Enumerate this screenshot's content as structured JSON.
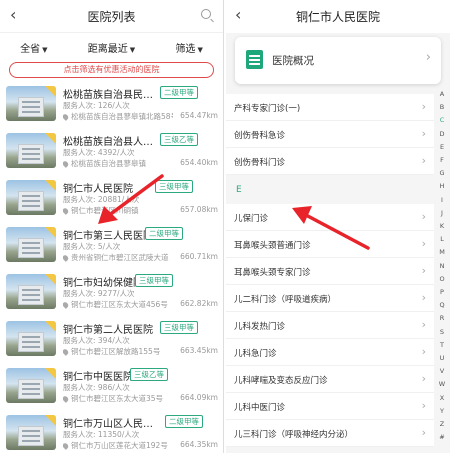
{
  "left": {
    "header": {
      "back_icon": "‹",
      "title": "医院列表"
    },
    "filters": [
      {
        "label": "全省"
      },
      {
        "label": "距离最近"
      },
      {
        "label": "筛选"
      }
    ],
    "banner": "点击筛选有优惠活动的医院",
    "hospitals": [
      {
        "name": "松桃苗族自治县民族...",
        "grade": "二级甲等",
        "served": "服务人次: 126/人次",
        "address": "松桃苗族自治县蓼皋镇北路58号",
        "distance": "654.47km"
      },
      {
        "name": "松桃苗族自治县人民...",
        "grade": "三级乙等",
        "served": "服务人次: 4392/人次",
        "address": "松桃苗族自治县蓼皋镇",
        "distance": "654.40km"
      },
      {
        "name": "铜仁市人民医院",
        "grade": "三级甲等",
        "served": "服务人次: 20881/人次",
        "address": "铜仁市碧江区川硐镇",
        "distance": "657.08km"
      },
      {
        "name": "铜仁市第三人民医院",
        "grade": "二级甲等",
        "served": "服务人次: 5/人次",
        "address": "贵州省铜仁市碧江区武陵大道",
        "distance": "660.71km"
      },
      {
        "name": "铜仁市妇幼保健院",
        "grade": "三级甲等",
        "served": "服务人次: 9277/人次",
        "address": "铜仁市碧江区东太大道456号",
        "distance": "662.82km"
      },
      {
        "name": "铜仁市第二人民医院",
        "grade": "三级甲等",
        "served": "服务人次: 394/人次",
        "address": "铜仁市碧江区解放路155号",
        "distance": "663.45km"
      },
      {
        "name": "铜仁市中医医院",
        "grade": "三级乙等",
        "served": "服务人次: 986/人次",
        "address": "铜仁市碧江区东太大道35号",
        "distance": "664.09km"
      },
      {
        "name": "铜仁市万山区人民医院",
        "grade": "二级甲等",
        "served": "服务人次: 11350/人次",
        "address": "铜仁市万山区莲花大道192号",
        "distance": "664.35km"
      }
    ]
  },
  "right": {
    "header": {
      "back_icon": "‹",
      "title": "铜仁市人民医院"
    },
    "overview_label": "医院概况",
    "group1": [
      "产科专家门诊(一)",
      "创伤骨科急诊",
      "创伤骨科门诊"
    ],
    "section_letter": "E",
    "group2": [
      "儿保门诊",
      "耳鼻喉头颈普通门诊",
      "耳鼻喉头颈专家门诊",
      "儿二科门诊（呼吸道疾病）",
      "儿科发热门诊",
      "儿科急门诊",
      "儿科哮喘及变态反应门诊",
      "儿科中医门诊",
      "儿三科门诊（呼吸神经内分泌）"
    ],
    "alphabet": [
      "A",
      "B",
      "C",
      "D",
      "E",
      "F",
      "G",
      "H",
      "I",
      "J",
      "K",
      "L",
      "M",
      "N",
      "O",
      "P",
      "Q",
      "R",
      "S",
      "T",
      "U",
      "V",
      "W",
      "X",
      "Y",
      "Z",
      "#"
    ],
    "alphabet_active": "C"
  },
  "colors": {
    "accent": "#2ca97f",
    "banner_red": "#e04a4a",
    "arrow_red": "#e8242a"
  }
}
